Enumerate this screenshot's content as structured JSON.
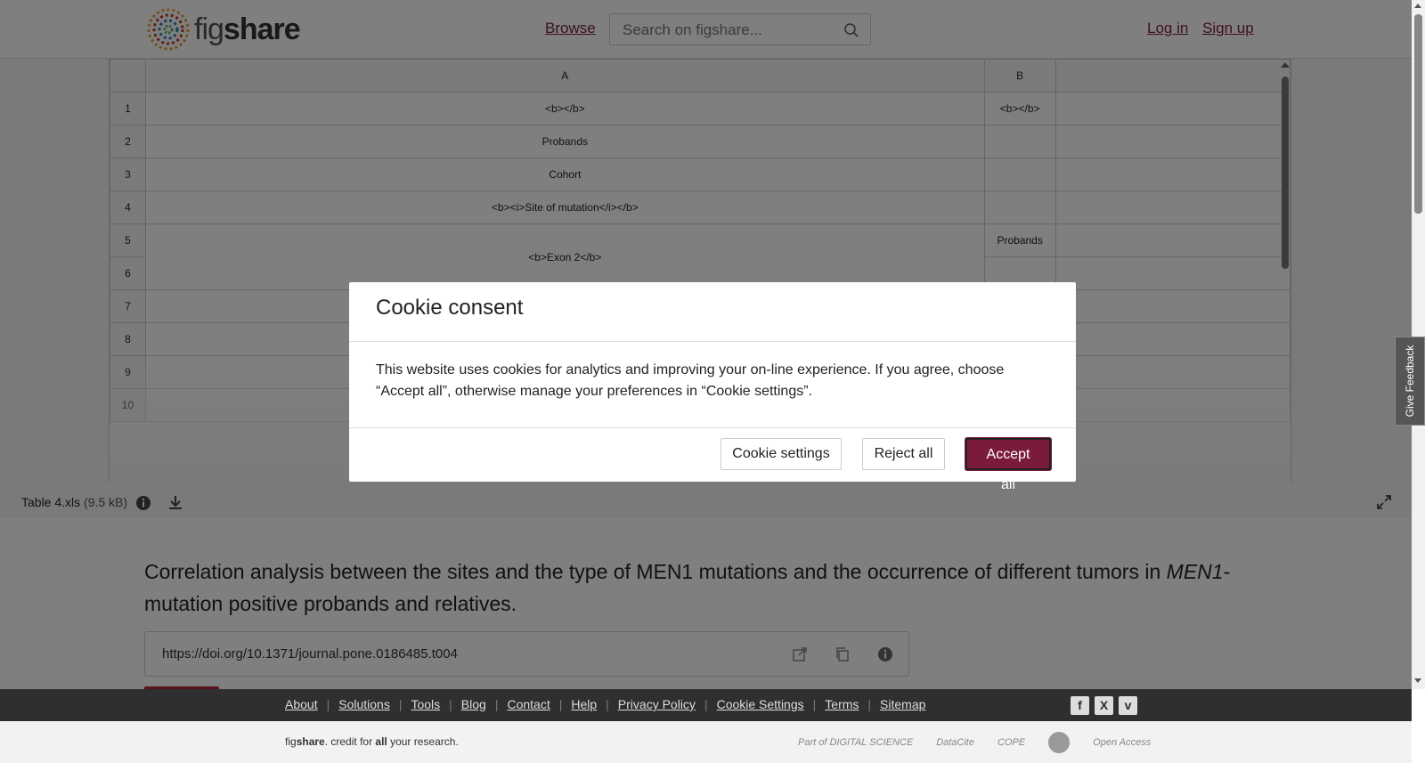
{
  "header": {
    "logo_text_light": "fig",
    "logo_text_bold": "share",
    "browse_label": "Browse",
    "search_placeholder": "Search on figshare...",
    "login_label": "Log in",
    "signup_label": "Sign up"
  },
  "sheet": {
    "columns": [
      "A",
      "B"
    ],
    "rows": [
      {
        "num": "1",
        "a": "<b></b>",
        "b": "<b></b>"
      },
      {
        "num": "2",
        "a": "Probands",
        "b": ""
      },
      {
        "num": "3",
        "a": "Cohort",
        "b": ""
      },
      {
        "num": "4",
        "a": "<b><i>Site of mutation</i></b>",
        "b": ""
      },
      {
        "num": "5",
        "a": "<b>Exon 2</b>",
        "b": "Probands"
      },
      {
        "num": "6",
        "a": "",
        "b": ""
      },
      {
        "num": "7",
        "a": "",
        "b": ""
      },
      {
        "num": "8",
        "a": "",
        "b": ""
      },
      {
        "num": "9",
        "a": "",
        "b": ""
      },
      {
        "num": "10",
        "a": "",
        "b": ""
      }
    ]
  },
  "file": {
    "name": "Table 4.xls",
    "size": "(9.5 kB)"
  },
  "article": {
    "title_part1": "Correlation analysis between the sites and the type of MEN1 mutations and the occurrence of different tumors in ",
    "title_italic": "MEN1",
    "title_part2": "-mutation positive probands and relatives.",
    "doi": "https://doi.org/10.1371/journal.pone.0186485.t004"
  },
  "footer": {
    "links": [
      "About",
      "Solutions",
      "Tools",
      "Blog",
      "Contact",
      "Help",
      "Privacy Policy",
      "Cookie Settings",
      "Terms",
      "Sitemap"
    ],
    "social": [
      "f",
      "X",
      "v"
    ],
    "tagline_light": "fig",
    "tagline_bold": "share",
    "tagline_rest1": ". credit for ",
    "tagline_all": "all",
    "tagline_rest2": " your research.",
    "partners": [
      "Part of DIGITAL SCIENCE",
      "DataCite",
      "COPE",
      "Open Access"
    ]
  },
  "feedback_label": "Give Feedback",
  "modal": {
    "title": "Cookie consent",
    "body": "This website uses cookies for analytics and improving your on-line experience. If you agree, choose “Accept all”, otherwise manage your preferences in “Cookie settings”.",
    "settings_label": "Cookie settings",
    "reject_label": "Reject all",
    "accept_label": "Accept all"
  },
  "colors": {
    "accent": "#7a1a3c",
    "footer_dark": "#2f2f2f"
  }
}
